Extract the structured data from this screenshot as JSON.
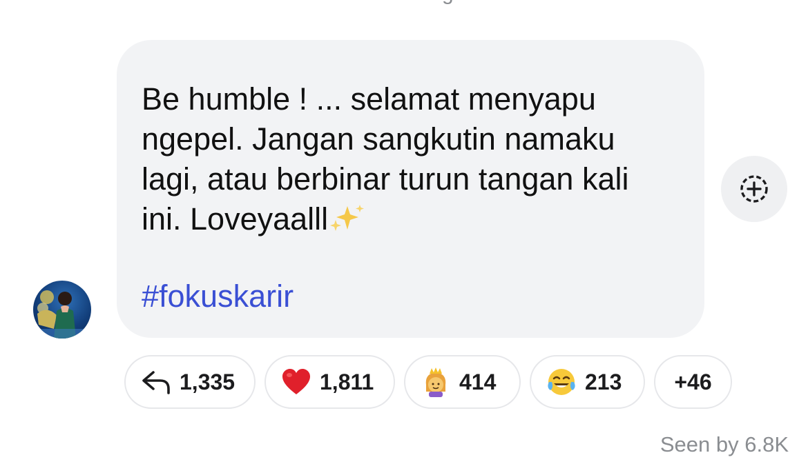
{
  "top_fragment": "g",
  "message": {
    "text": "Be humble ! ... selamat menyapu\nngepel. Jangan sangkutin namaku\nlagi, atau berbinar turun tangan kali\nini. Loveyaalll",
    "hashtag": "#fokuskarir"
  },
  "reactions": [
    {
      "icon": "reply-icon",
      "count": "1,335"
    },
    {
      "icon": "red-heart-emoji",
      "count": "1,811"
    },
    {
      "icon": "princess-emoji",
      "count": "414"
    },
    {
      "icon": "tears-of-joy-emoji",
      "count": "213"
    },
    {
      "count": "+46"
    }
  ],
  "seen": "Seen by 6.8K",
  "colors": {
    "bubble": "#f2f3f5",
    "hashtag": "#3a4fd4",
    "muted": "#8a8d91"
  }
}
